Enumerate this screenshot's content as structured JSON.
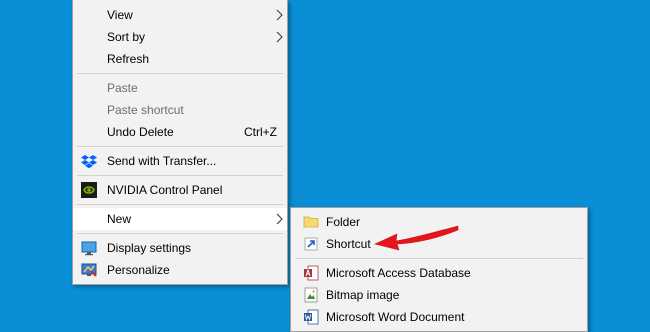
{
  "desktop": {
    "background_color": "#0a8fd6"
  },
  "context_menu": {
    "items": [
      {
        "label": "View",
        "has_submenu": true
      },
      {
        "label": "Sort by",
        "has_submenu": true
      },
      {
        "label": "Refresh"
      },
      {
        "label": "Paste",
        "disabled": true
      },
      {
        "label": "Paste shortcut",
        "disabled": true
      },
      {
        "label": "Undo Delete",
        "shortcut": "Ctrl+Z"
      },
      {
        "label": "Send with Transfer...",
        "icon": "dropbox-icon"
      },
      {
        "label": "NVIDIA Control Panel",
        "icon": "nvidia-icon"
      },
      {
        "label": "New",
        "has_submenu": true,
        "highlighted": true
      },
      {
        "label": "Display settings",
        "icon": "display-icon"
      },
      {
        "label": "Personalize",
        "icon": "personalize-icon"
      }
    ]
  },
  "new_submenu": {
    "items": [
      {
        "label": "Folder",
        "icon": "folder-icon"
      },
      {
        "label": "Shortcut",
        "icon": "shortcut-icon"
      },
      {
        "label": "Microsoft Access Database",
        "icon": "access-icon"
      },
      {
        "label": "Bitmap image",
        "icon": "bitmap-icon"
      },
      {
        "label": "Microsoft Word Document",
        "icon": "word-icon"
      }
    ]
  },
  "annotation": {
    "arrow_color": "#e8141c"
  }
}
